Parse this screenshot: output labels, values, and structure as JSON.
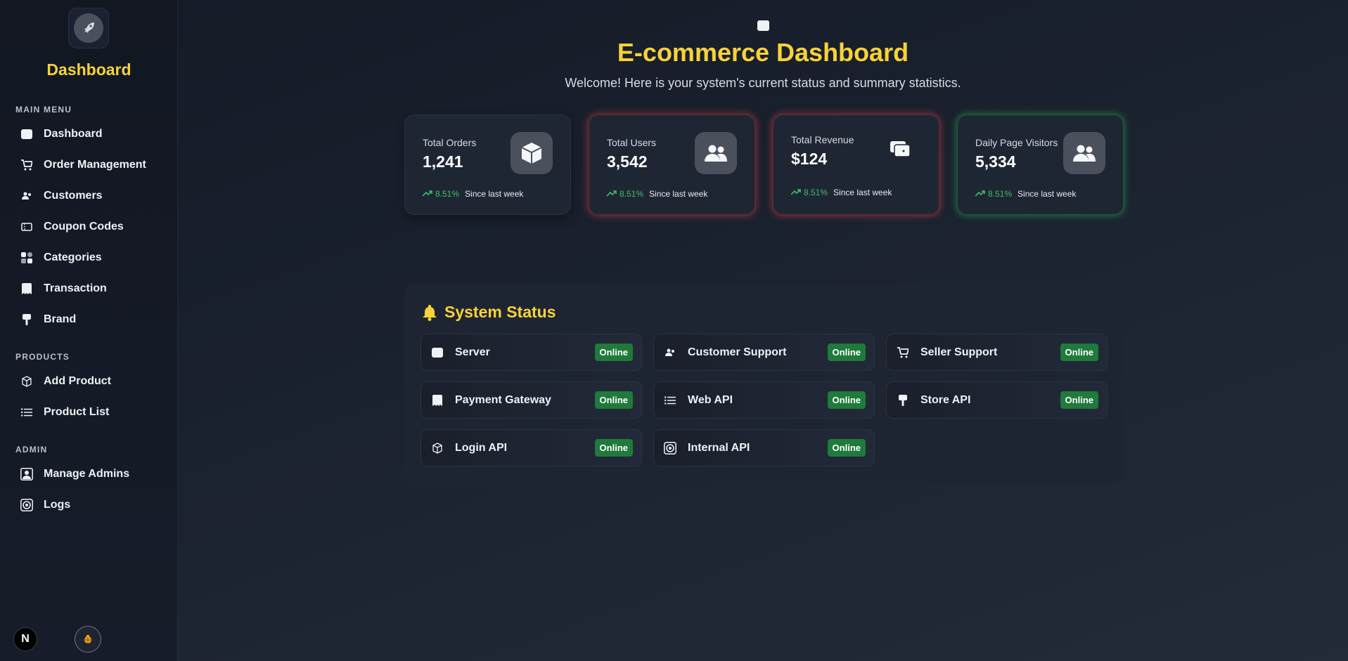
{
  "sidebar": {
    "title": "Dashboard",
    "sections": {
      "main": "MAIN MENU",
      "products": "PRODUCTS",
      "admin": "ADMIN"
    },
    "items": [
      {
        "label": "Dashboard",
        "icon": "dashboard-icon"
      },
      {
        "label": "Order Management",
        "icon": "cart-icon"
      },
      {
        "label": "Customers",
        "icon": "users-icon"
      },
      {
        "label": "Coupon Codes",
        "icon": "ticket-icon"
      },
      {
        "label": "Categories",
        "icon": "grid-icon"
      },
      {
        "label": "Transaction",
        "icon": "receipt-icon"
      },
      {
        "label": "Brand",
        "icon": "brand-icon"
      },
      {
        "label": "Add Product",
        "icon": "box-icon"
      },
      {
        "label": "Product List",
        "icon": "list-icon"
      },
      {
        "label": "Manage Admins",
        "icon": "admin-icon"
      },
      {
        "label": "Logs",
        "icon": "logs-icon"
      }
    ],
    "footer_badge": "N"
  },
  "header": {
    "title": "E-commerce Dashboard",
    "subtitle": "Welcome! Here is your system's current status and summary statistics."
  },
  "stats": [
    {
      "label": "Total Orders",
      "value": "1,241",
      "pct": "8.51%",
      "since": "Since last week",
      "glow": "none"
    },
    {
      "label": "Total Users",
      "value": "3,542",
      "pct": "8.51%",
      "since": "Since last week",
      "glow": "red"
    },
    {
      "label": "Total Revenue",
      "value": "$124",
      "pct": "8.51%",
      "since": "Since last week",
      "glow": "red"
    },
    {
      "label": "Daily Page Visitors",
      "value": "5,334",
      "pct": "8.51%",
      "since": "Since last week",
      "glow": "green"
    }
  ],
  "status": {
    "title": "System Status",
    "items": [
      {
        "label": "Server",
        "state": "Online"
      },
      {
        "label": "Customer Support",
        "state": "Online"
      },
      {
        "label": "Seller Support",
        "state": "Online"
      },
      {
        "label": "Payment Gateway",
        "state": "Online"
      },
      {
        "label": "Web API",
        "state": "Online"
      },
      {
        "label": "Store API",
        "state": "Online"
      },
      {
        "label": "Login API",
        "state": "Online"
      },
      {
        "label": "Internal API",
        "state": "Online"
      }
    ]
  },
  "colors": {
    "accent": "#f8d238",
    "online": "#1f7a3c",
    "trend": "#3cc06a"
  }
}
